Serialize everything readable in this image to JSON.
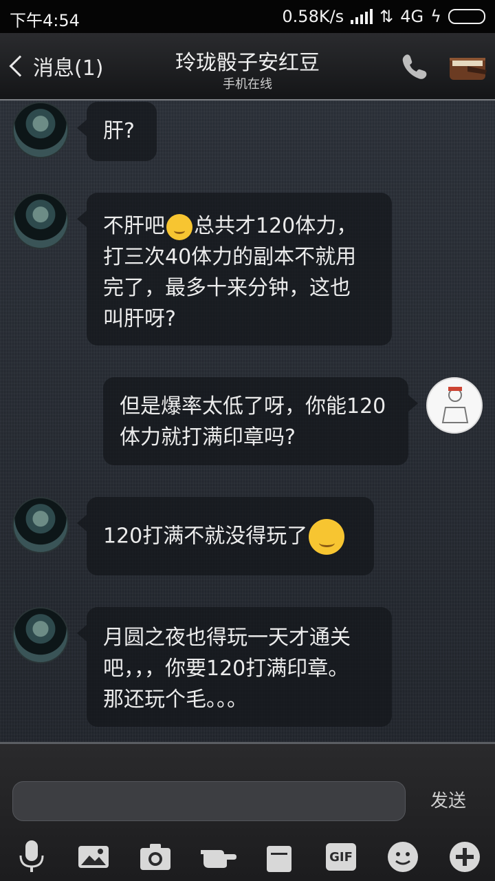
{
  "status_bar": {
    "time": "下午4:54",
    "speed": "0.58K/s",
    "network": "4G",
    "charging_symbol": "ϟ"
  },
  "header": {
    "back_label": "消息(1)",
    "title": "玲珑骰子安红豆",
    "subtitle": "手机在线",
    "call_icon": "phone-icon",
    "profile_icon": "book-icon"
  },
  "messages": [
    {
      "sender": "other",
      "lines": [
        "肝?"
      ]
    },
    {
      "sender": "other",
      "lines": [
        "不肝吧",
        "😂",
        "总共才120体力，",
        "打三次40体力的副本不就用",
        "完了，最多十来分钟，这也",
        "叫肝呀?"
      ]
    },
    {
      "sender": "me",
      "lines": [
        "但是爆率太低了呀，你能120",
        "体力就打满印章吗?"
      ]
    },
    {
      "sender": "other",
      "lines": [
        "120打满不就没得玩了"
      ],
      "emoji": "blush-emoji"
    },
    {
      "sender": "other",
      "lines": [
        "月圆之夜也得玩一天才通关",
        "吧，，，你要120打满印章。",
        "那还玩个毛。。。"
      ]
    }
  ],
  "input": {
    "value": "",
    "send_label": "发送"
  },
  "toolbar": {
    "items": [
      "microphone-icon",
      "image-icon",
      "camera-icon",
      "poke-icon",
      "folder-icon",
      "gif-icon",
      "emoji-icon",
      "plus-icon"
    ],
    "gif_label": "GIF"
  }
}
